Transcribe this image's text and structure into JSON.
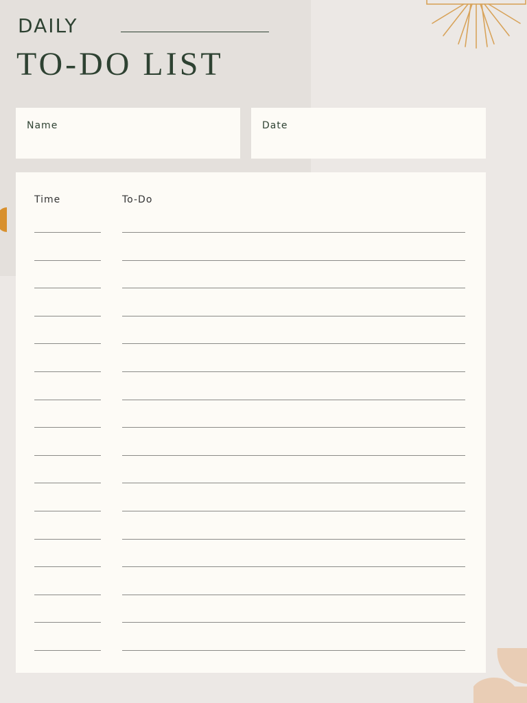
{
  "header": {
    "title_small": "DAILY",
    "title_big": "TO-DO LIST"
  },
  "fields": {
    "name_label": "Name",
    "date_label": "Date"
  },
  "list": {
    "time_header": "Time",
    "todo_header": "To-Do",
    "row_count": 16
  },
  "colors": {
    "background": "#ece8e5",
    "panel": "#e4e0dc",
    "card": "#fdfbf6",
    "text_dark_green": "#2e4232",
    "accent_orange": "#d8902d",
    "accent_peach": "#e9cdb5"
  },
  "decorations": [
    "sunburst",
    "orange-half-circle",
    "peach-half-circles"
  ]
}
